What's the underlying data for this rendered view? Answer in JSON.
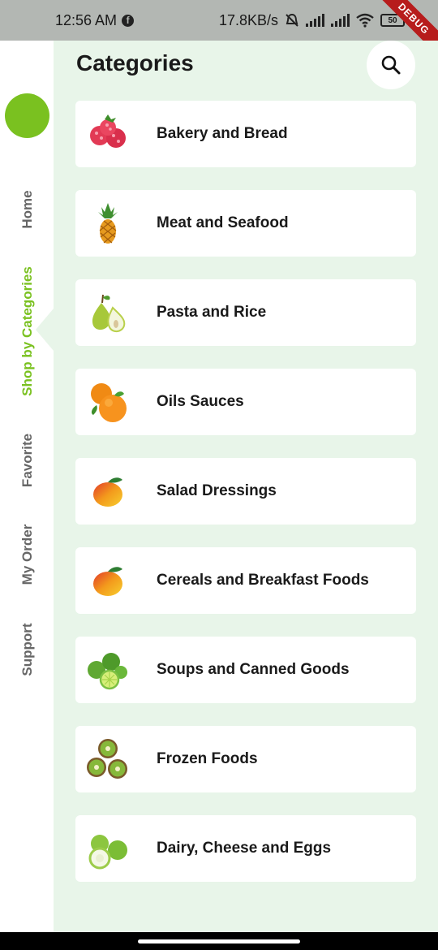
{
  "status": {
    "time": "12:56 AM",
    "fb_glyph": "f",
    "speed": "17.8KB/s",
    "battery": "50",
    "debug": "DEBUG"
  },
  "sidebar": {
    "items": [
      {
        "label": "Home",
        "active": false
      },
      {
        "label": "Shop by Categories",
        "active": true
      },
      {
        "label": "Favorite",
        "active": false
      },
      {
        "label": "My Order",
        "active": false
      },
      {
        "label": "Support",
        "active": false
      }
    ],
    "accent": "#7ac120"
  },
  "header": {
    "title": "Categories",
    "search_icon": "search-icon"
  },
  "categories": [
    {
      "label": "Bakery and Bread",
      "icon": "raspberry-icon"
    },
    {
      "label": "Meat and Seafood",
      "icon": "pineapple-icon"
    },
    {
      "label": "Pasta and Rice",
      "icon": "pear-icon"
    },
    {
      "label": "Oils Sauces",
      "icon": "orange-icon"
    },
    {
      "label": "Salad Dressings",
      "icon": "mango-icon"
    },
    {
      "label": "Cereals and Breakfast Foods",
      "icon": "mango-icon"
    },
    {
      "label": "Soups and Canned Goods",
      "icon": "lime-icon"
    },
    {
      "label": "Frozen Foods",
      "icon": "kiwi-icon"
    },
    {
      "label": "Dairy, Cheese and Eggs",
      "icon": "guava-icon"
    }
  ],
  "colors": {
    "background": "#e8f5e9",
    "accent": "#7ac120",
    "card": "#ffffff"
  }
}
